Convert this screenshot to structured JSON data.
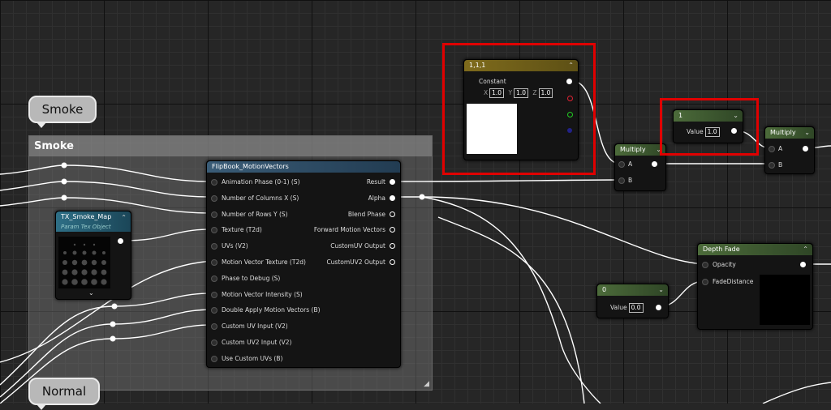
{
  "comment": {
    "bubble_top": "Smoke",
    "title": "Smoke",
    "bubble_bottom": "Normal"
  },
  "constant3": {
    "header": "1,1,1",
    "label": "Constant",
    "x_label": "X",
    "x_value": "1.0",
    "y_label": "Y",
    "y_value": "1.0",
    "z_label": "Z",
    "z_value": "1.0",
    "swatch_color": "#ffffff"
  },
  "multiply1": {
    "header": "Multiply",
    "pin_a": "A",
    "pin_b": "B"
  },
  "scalar1": {
    "header": "1",
    "value_label": "Value",
    "value": "1.0"
  },
  "multiply2": {
    "header": "Multiply",
    "pin_a": "A",
    "pin_b": "B"
  },
  "flipbook": {
    "header": "FlipBook_MotionVectors",
    "inputs": [
      "Animation Phase (0-1) (S)",
      "Number of Columns X (S)",
      "Number of Rows Y (S)",
      "Texture (T2d)",
      "UVs (V2)",
      "Motion Vector Texture (T2d)",
      "Phase to Debug (S)",
      "Motion Vector Intensity (S)",
      "Double Apply Motion Vectors (B)",
      "Custom UV Input (V2)",
      "Custom UV2 Input (V2)",
      "Use Custom UVs (B)"
    ],
    "outputs": [
      "Result",
      "Alpha",
      "Blend Phase",
      "Forward Motion Vectors",
      "CustomUV Output",
      "CustomUV2 Output"
    ]
  },
  "texparam": {
    "header": "TX_Smoke_Map",
    "subheader": "Param Tex Object"
  },
  "depthfade": {
    "header": "Depth Fade",
    "pin_opacity": "Opacity",
    "pin_fade": "FadeDistance"
  },
  "scalar0": {
    "header": "0",
    "value_label": "Value",
    "value": "0.0"
  },
  "colors": {
    "highlight": "#e00000",
    "wire": "#ffffff"
  }
}
